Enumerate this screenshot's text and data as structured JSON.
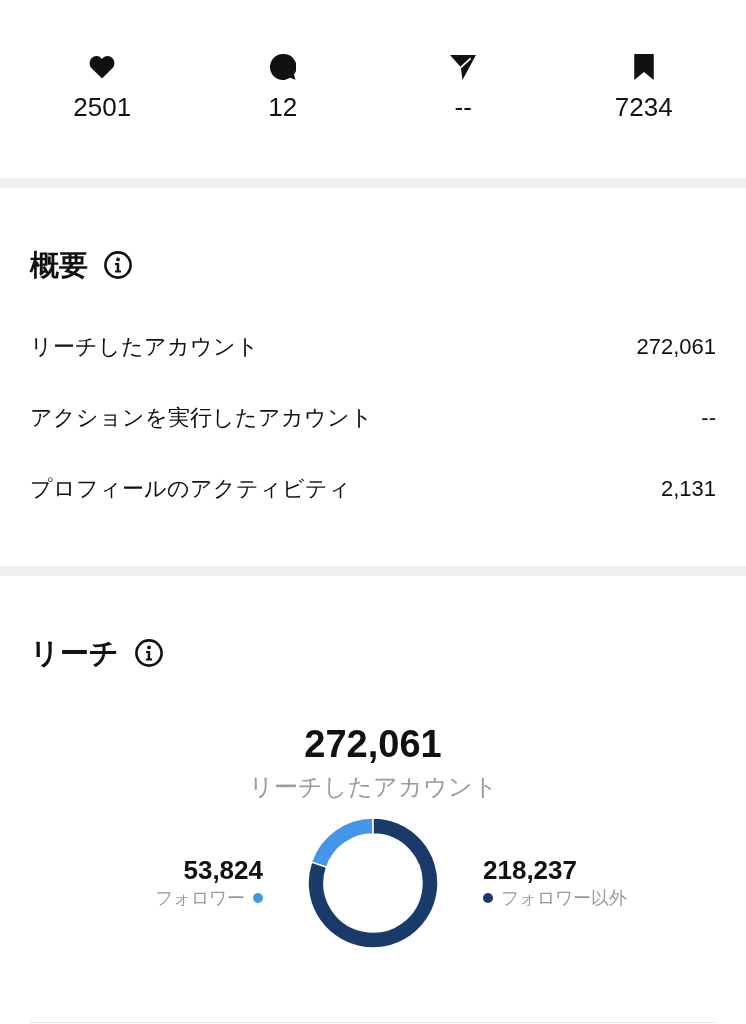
{
  "stats": [
    {
      "kind": "like",
      "count": "2501"
    },
    {
      "kind": "comment",
      "count": "12"
    },
    {
      "kind": "share",
      "count": "--"
    },
    {
      "kind": "save",
      "count": "7234"
    }
  ],
  "overview": {
    "title": "概要",
    "rows": [
      {
        "label": "リーチしたアカウント",
        "value": "272,061"
      },
      {
        "label": "アクションを実行したアカウント",
        "value": "--"
      },
      {
        "label": "プロフィールのアクティビティ",
        "value": "2,131"
      }
    ]
  },
  "reach": {
    "title": "リーチ",
    "total": "272,061",
    "total_label": "リーチしたアカウント",
    "chart_data": {
      "type": "donut",
      "values": [
        19.8,
        80.2
      ]
    },
    "legend": [
      {
        "value": "53,824",
        "label": "フォロワー",
        "color": "#4596e8"
      },
      {
        "value": "218,237",
        "label": "フォロワー以外",
        "color": "#1a3a6a"
      }
    ]
  }
}
